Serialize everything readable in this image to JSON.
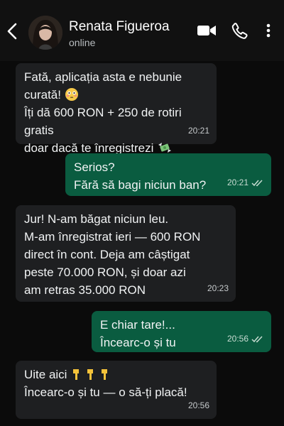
{
  "contact": {
    "name": "Renata Figueroa",
    "status": "online"
  },
  "icons": {
    "back": "back-arrow-icon",
    "video": "video-call-icon",
    "call": "phone-icon",
    "menu": "more-vertical-icon",
    "read_receipt": "double-check-icon",
    "flushed": "flushed-face-emoji",
    "money": "money-with-wings-emoji",
    "point_down": "backhand-index-pointing-down-emoji"
  },
  "colors": {
    "background": "#0b0b0b",
    "incoming_bubble": "#1e1f21",
    "outgoing_bubble": "#0a5c40"
  },
  "messages": [
    {
      "direction": "incoming",
      "line1": "Fată, aplicația asta e nebunie",
      "line2": "curată!",
      "line3": "Îți dă 600 RON + 250 de rotiri gratis",
      "line4": "doar dacă te înregistrezi",
      "time": "20:21"
    },
    {
      "direction": "outgoing",
      "line1": "Serios?",
      "line2": "Fără să bagi niciun ban?",
      "time": "20:21"
    },
    {
      "direction": "incoming",
      "text": "Jur! N-am băgat niciun leu.\nM-am înregistrat ieri — 600 RON\ndirect în cont. Deja am câștigat\npeste 70.000 RON, și doar azi\nam retras 35.000 RON",
      "time": "20:23"
    },
    {
      "direction": "outgoing",
      "line1": "E chiar tare!...",
      "line2": "Încearc-o și tu",
      "time": "20:56"
    },
    {
      "direction": "incoming",
      "line1": "Uite aici",
      "line2": "Încearc-o și tu — o să-ți placă!",
      "time": "20:56"
    }
  ]
}
